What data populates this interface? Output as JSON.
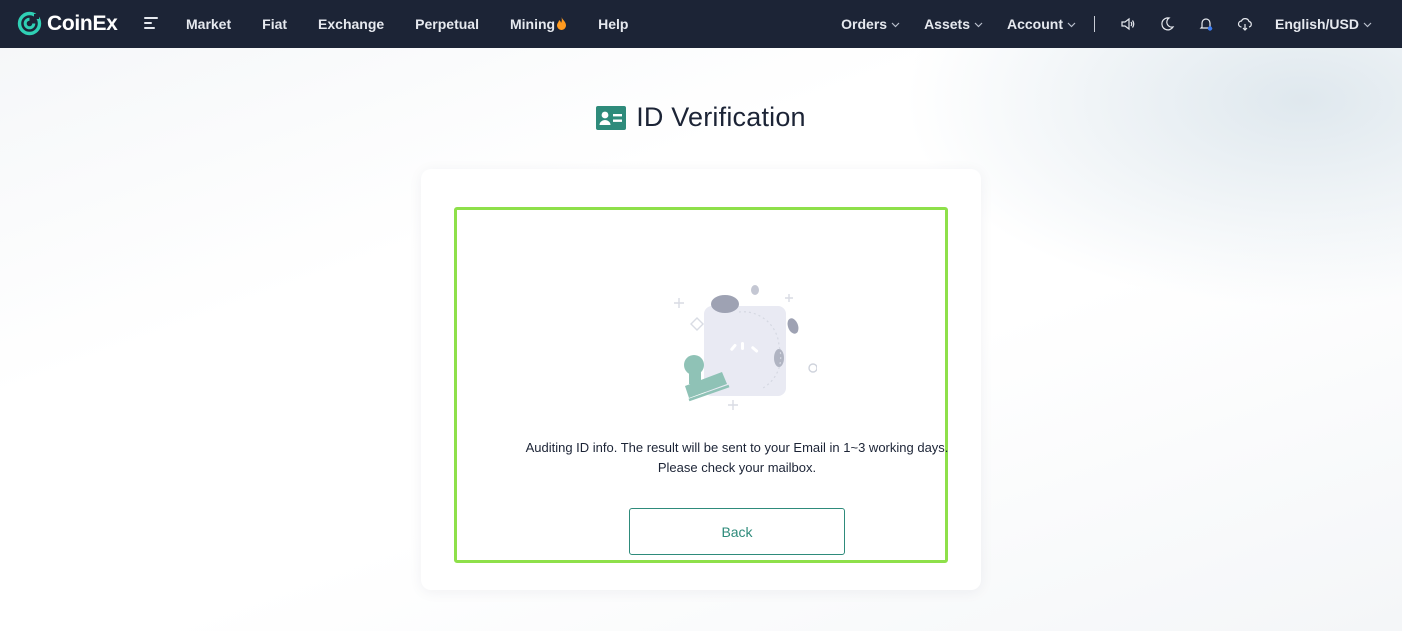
{
  "brand": {
    "name": "CoinEx",
    "accent_color": "#2e8b7b",
    "topbar_color": "#1c2436",
    "highlight_color": "#8ee04a"
  },
  "nav": {
    "menu_icon": "hamburger-icon",
    "left_items": [
      "Market",
      "Fiat",
      "Exchange",
      "Perpetual",
      "Mining",
      "Help"
    ],
    "mining_badge_icon": "fire-icon",
    "right_items": [
      {
        "label": "Orders",
        "icon": "chevron-down-icon"
      },
      {
        "label": "Assets",
        "icon": "chevron-down-icon"
      },
      {
        "label": "Account",
        "icon": "chevron-down-icon"
      }
    ],
    "icons": [
      "speaker-icon",
      "moon-icon",
      "bell-icon",
      "download-icon"
    ],
    "language": "English/USD"
  },
  "page": {
    "title": "ID Verification",
    "title_icon": "id-card-icon"
  },
  "status": {
    "illustration": "audit-stamp-illustration",
    "message": "Auditing ID info. The result will be sent to your Email in 1~3 working days. Please check your mailbox.",
    "back_label": "Back"
  }
}
